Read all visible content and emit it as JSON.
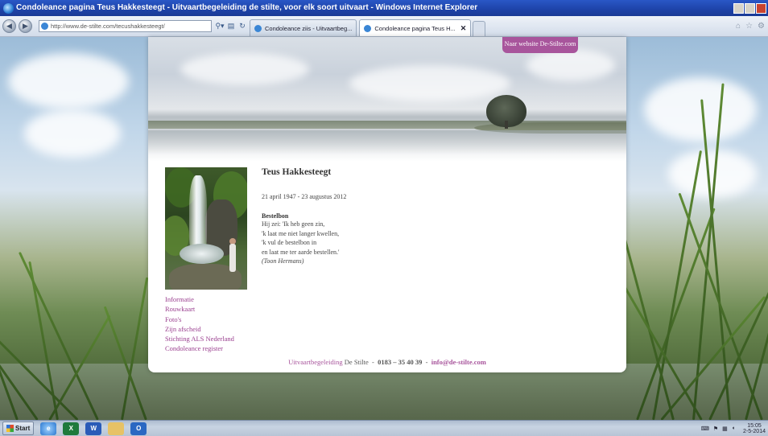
{
  "window": {
    "title": "Condoleance pagina Teus Hakkesteegt - Uitvaartbegeleiding de stilte, voor elk soort uitvaart - Windows Internet Explorer"
  },
  "browser": {
    "address": "http://www.de-stilte.com/tecushakkesteegt/",
    "address_host": "de-stilte",
    "tabs": [
      {
        "label": "Condoleance ziis - Uitvaartbeg...",
        "active": false
      },
      {
        "label": "Condoleance pagina Teus H...",
        "active": true
      }
    ],
    "tab_close": "✕"
  },
  "page": {
    "site_link": "Naar website De-Stilte.com",
    "name": "Teus Hakkesteegt",
    "dates": "21 april 1947 - 23 augustus 2012",
    "poem_title": "Bestelbon",
    "poem_lines": [
      "Hij zei: 'Ik heb geen zin,",
      "'k laat me niet langer kwellen,",
      "'k vul de bestelbon in",
      "en laat me ter aarde bestellen.'"
    ],
    "poem_author": "(Toon Hermans)",
    "menu": [
      "Informatie",
      "Rouwkaart",
      "Foto's",
      "Zijn afscheid",
      "Stichting ALS Nederland",
      "Condoleance register"
    ],
    "footer": {
      "brand_prefix": "Uitvaartbegeleiding",
      "brand": "De Stilte",
      "sep": "-",
      "phone": "0183 – 35 40 39",
      "email": "info@de-stilte.com"
    }
  },
  "taskbar": {
    "start": "Start",
    "apps": [
      "internet-explorer",
      "excel",
      "word",
      "explorer-folder",
      "outlook"
    ],
    "clock_time": "15:05",
    "clock_date": "2-5-2014"
  },
  "colors": {
    "accent": "#a8559c",
    "link": "#9a3f8f"
  }
}
